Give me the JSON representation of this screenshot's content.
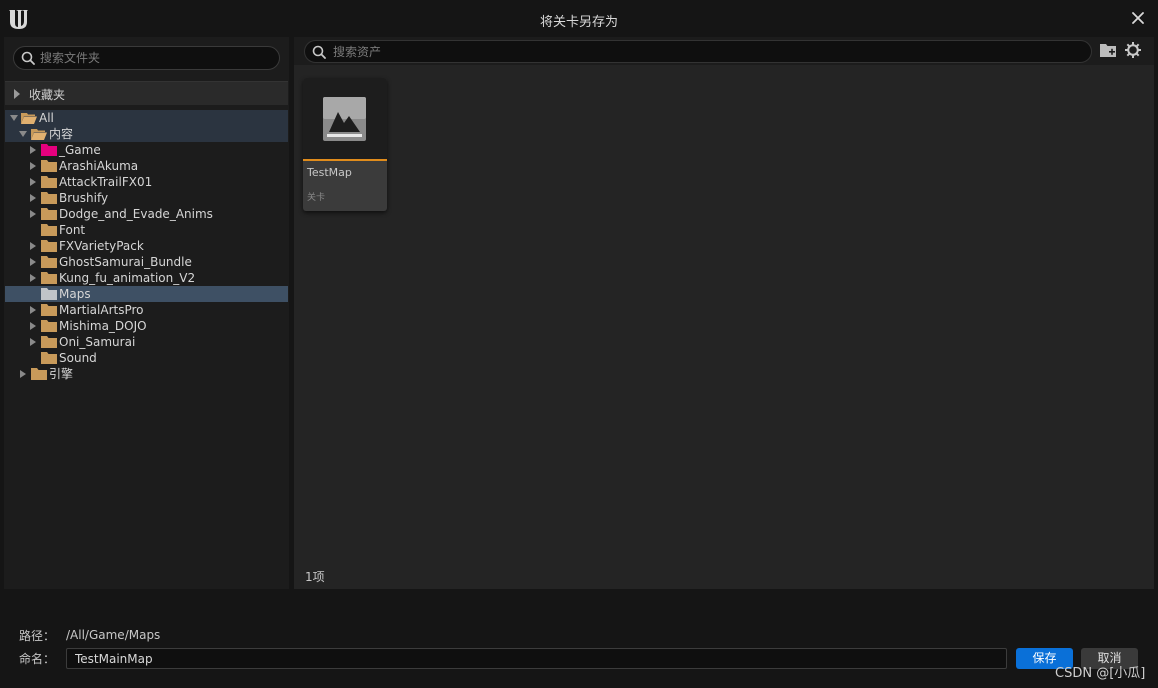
{
  "window": {
    "title": "将关卡另存为",
    "logo": "unreal-engine-logo",
    "close_icon": "close-icon"
  },
  "left_panel": {
    "search_placeholder": "搜索文件夹",
    "favorites_label": "收藏夹",
    "tree": {
      "all": "All",
      "content": "内容",
      "folders": [
        {
          "label": "_Game",
          "color": "#e6007e",
          "expandable": true
        },
        {
          "label": "ArashiAkuma",
          "color": "#c89a5a",
          "expandable": true
        },
        {
          "label": "AttackTrailFX01",
          "color": "#c89a5a",
          "expandable": true
        },
        {
          "label": "Brushify",
          "color": "#c89a5a",
          "expandable": true
        },
        {
          "label": "Dodge_and_Evade_Anims",
          "color": "#c89a5a",
          "expandable": true
        },
        {
          "label": "Font",
          "color": "#c89a5a",
          "expandable": false
        },
        {
          "label": "FXVarietyPack",
          "color": "#c89a5a",
          "expandable": true
        },
        {
          "label": "GhostSamurai_Bundle",
          "color": "#c89a5a",
          "expandable": true
        },
        {
          "label": "Kung_fu_animation_V2",
          "color": "#c89a5a",
          "expandable": true
        },
        {
          "label": "Maps",
          "color": "#c0c4c8",
          "expandable": false,
          "selected": true
        },
        {
          "label": "MartialArtsPro",
          "color": "#c89a5a",
          "expandable": true
        },
        {
          "label": "Mishima_DOJO",
          "color": "#c89a5a",
          "expandable": true
        },
        {
          "label": "Oni_Samurai",
          "color": "#c89a5a",
          "expandable": true
        },
        {
          "label": "Sound",
          "color": "#c89a5a",
          "expandable": false
        }
      ],
      "engine": "引擎"
    }
  },
  "right_panel": {
    "search_placeholder": "搜索资产",
    "asset": {
      "name": "TestMap",
      "type": "关卡",
      "accent_color": "#e08c1c"
    },
    "item_count": "1项"
  },
  "footer": {
    "path_label": "路径：",
    "path_value": "/All/Game/Maps",
    "name_label": "命名：",
    "name_value": "TestMainMap",
    "save_label": "保存",
    "cancel_label": "取消",
    "save_color": "#0a70d8"
  },
  "watermark": "CSDN @[小瓜]"
}
